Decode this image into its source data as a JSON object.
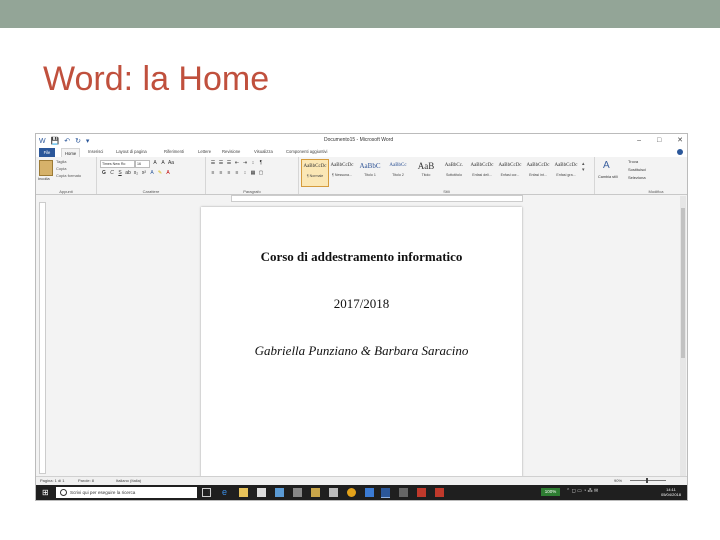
{
  "slide": {
    "title": "Word: la Home"
  },
  "colors": {
    "topbar": "#93a597",
    "title": "#c0503d",
    "word_blue": "#2b579a"
  },
  "window": {
    "title": "Documento15 - Microsoft Word",
    "controls": [
      "–",
      "□",
      "✕"
    ]
  },
  "qat": {
    "icons": [
      "W",
      "💾",
      "↶",
      "↻",
      "▾"
    ]
  },
  "ribbon": {
    "tabs": [
      "File",
      "Home",
      "Inserisci",
      "Layout di pagina",
      "Riferimenti",
      "Lettere",
      "Revisione",
      "Visualizza",
      "Componenti aggiuntivi"
    ],
    "clipboard": {
      "paste": "Incolla",
      "cut": "Taglia",
      "copy": "Copia",
      "format_painter": "Copia formato",
      "label": "Appunti"
    },
    "font": {
      "name": "Times New Ro",
      "size": "16",
      "label": "Carattere"
    },
    "paragraph": {
      "label": "Paragrafo"
    },
    "styles": {
      "label": "Stili",
      "items": [
        {
          "preview": "AaBbCcDc",
          "name": "¶ Normale",
          "size": "",
          "color": ""
        },
        {
          "preview": "AaBbCcDc",
          "name": "¶ Nessuna...",
          "size": "",
          "color": ""
        },
        {
          "preview": "AaBbC",
          "name": "Titolo 1",
          "size": "big",
          "color": "blue"
        },
        {
          "preview": "AaBbCc",
          "name": "Titolo 2",
          "size": "",
          "color": "blue"
        },
        {
          "preview": "AaB",
          "name": "Titolo",
          "size": "big",
          "color": ""
        },
        {
          "preview": "AaBbCc.",
          "name": "Sottotitolo",
          "size": "",
          "color": ""
        },
        {
          "preview": "AaBbCcDc",
          "name": "Enfasi deli...",
          "size": "",
          "color": ""
        },
        {
          "preview": "AaBbCcDc",
          "name": "Enfasi cor...",
          "size": "",
          "color": ""
        },
        {
          "preview": "AaBbCcDc",
          "name": "Enfasi int...",
          "size": "",
          "color": ""
        },
        {
          "preview": "AaBbCcDc",
          "name": "Enfasi gra...",
          "size": "",
          "color": ""
        }
      ],
      "change": "Cambia stili"
    },
    "editing": {
      "find": "Trova",
      "replace": "Sostituisci",
      "select": "Seleziona",
      "label": "Modifica"
    }
  },
  "document": {
    "lines": [
      "Corso di addestramento informatico",
      "2017/2018",
      "Gabriella Punziano & Barbara Saracino"
    ]
  },
  "status": {
    "page": "Pagina: 1 di 1",
    "words": "Parole: 8",
    "language": "Italiano (Italia)",
    "zoom": "90%"
  },
  "taskbar": {
    "search_placeholder": "Scrivi qui per eseguire la ricerca",
    "battery": "100%",
    "time": "14:11",
    "date": "05/04/2018"
  }
}
